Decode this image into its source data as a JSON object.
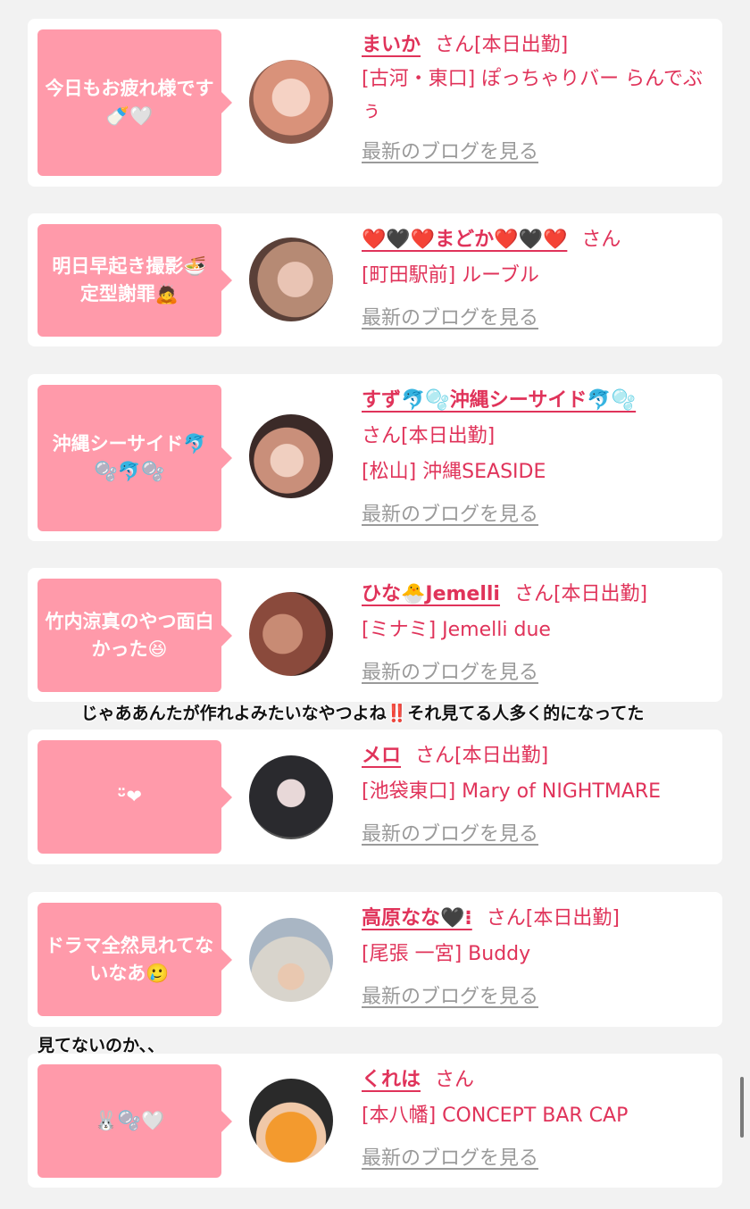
{
  "cards": [
    {
      "bubble": "今日もお疲れ様です🍼🤍",
      "name": "まいか",
      "honorific": "さん[本日出勤]",
      "shop": "[古河・東口] ぽっちゃりバー らんでぶぅ",
      "blog_link": "最新のブログを見る"
    },
    {
      "bubble": "明日早起き撮影🍜定型謝罪🙇",
      "name": "❤️🖤❤️まどか❤️🖤❤️",
      "honorific": "さん",
      "shop": "[町田駅前] ルーブル",
      "blog_link": "最新のブログを見る"
    },
    {
      "bubble": "沖縄シーサイド🐬🫧🐬🫧",
      "name": "すず🐬🫧沖縄シーサイド🐬🫧",
      "honorific": "さん[本日出勤]",
      "shop": "[松山] 沖縄SEASIDE",
      "blog_link": "最新のブログを見る"
    },
    {
      "bubble": "竹内涼真のやつ面白かった😆",
      "name": "ひな🐣Jemelli",
      "honorific": "さん[本日出勤]",
      "shop": "[ミナミ] Jemelli due",
      "blog_link": "最新のブログを見る"
    },
    {
      "bubble": "ᵕ̈❤",
      "name": "メロ",
      "honorific": "さん[本日出勤]",
      "shop": "[池袋東口] Mary of NIGHTMARE",
      "blog_link": "最新のブログを見る"
    },
    {
      "bubble": "ドラマ全然見れてないなあ🥲",
      "name": "高原なな🖤⁝",
      "honorific": "さん[本日出勤]",
      "shop": "[尾張 一宮] Buddy",
      "blog_link": "最新のブログを見る"
    },
    {
      "bubble": "🐰🫧🤍",
      "name": "くれは",
      "honorific": "さん",
      "shop": "[本八幡] CONCEPT BAR CAP",
      "blog_link": "最新のブログを見る"
    }
  ],
  "captions": [
    "じゃああんたが作れよみたいなやつよね‼️それ見てる人多く的になってた",
    "見てないのか、、"
  ]
}
